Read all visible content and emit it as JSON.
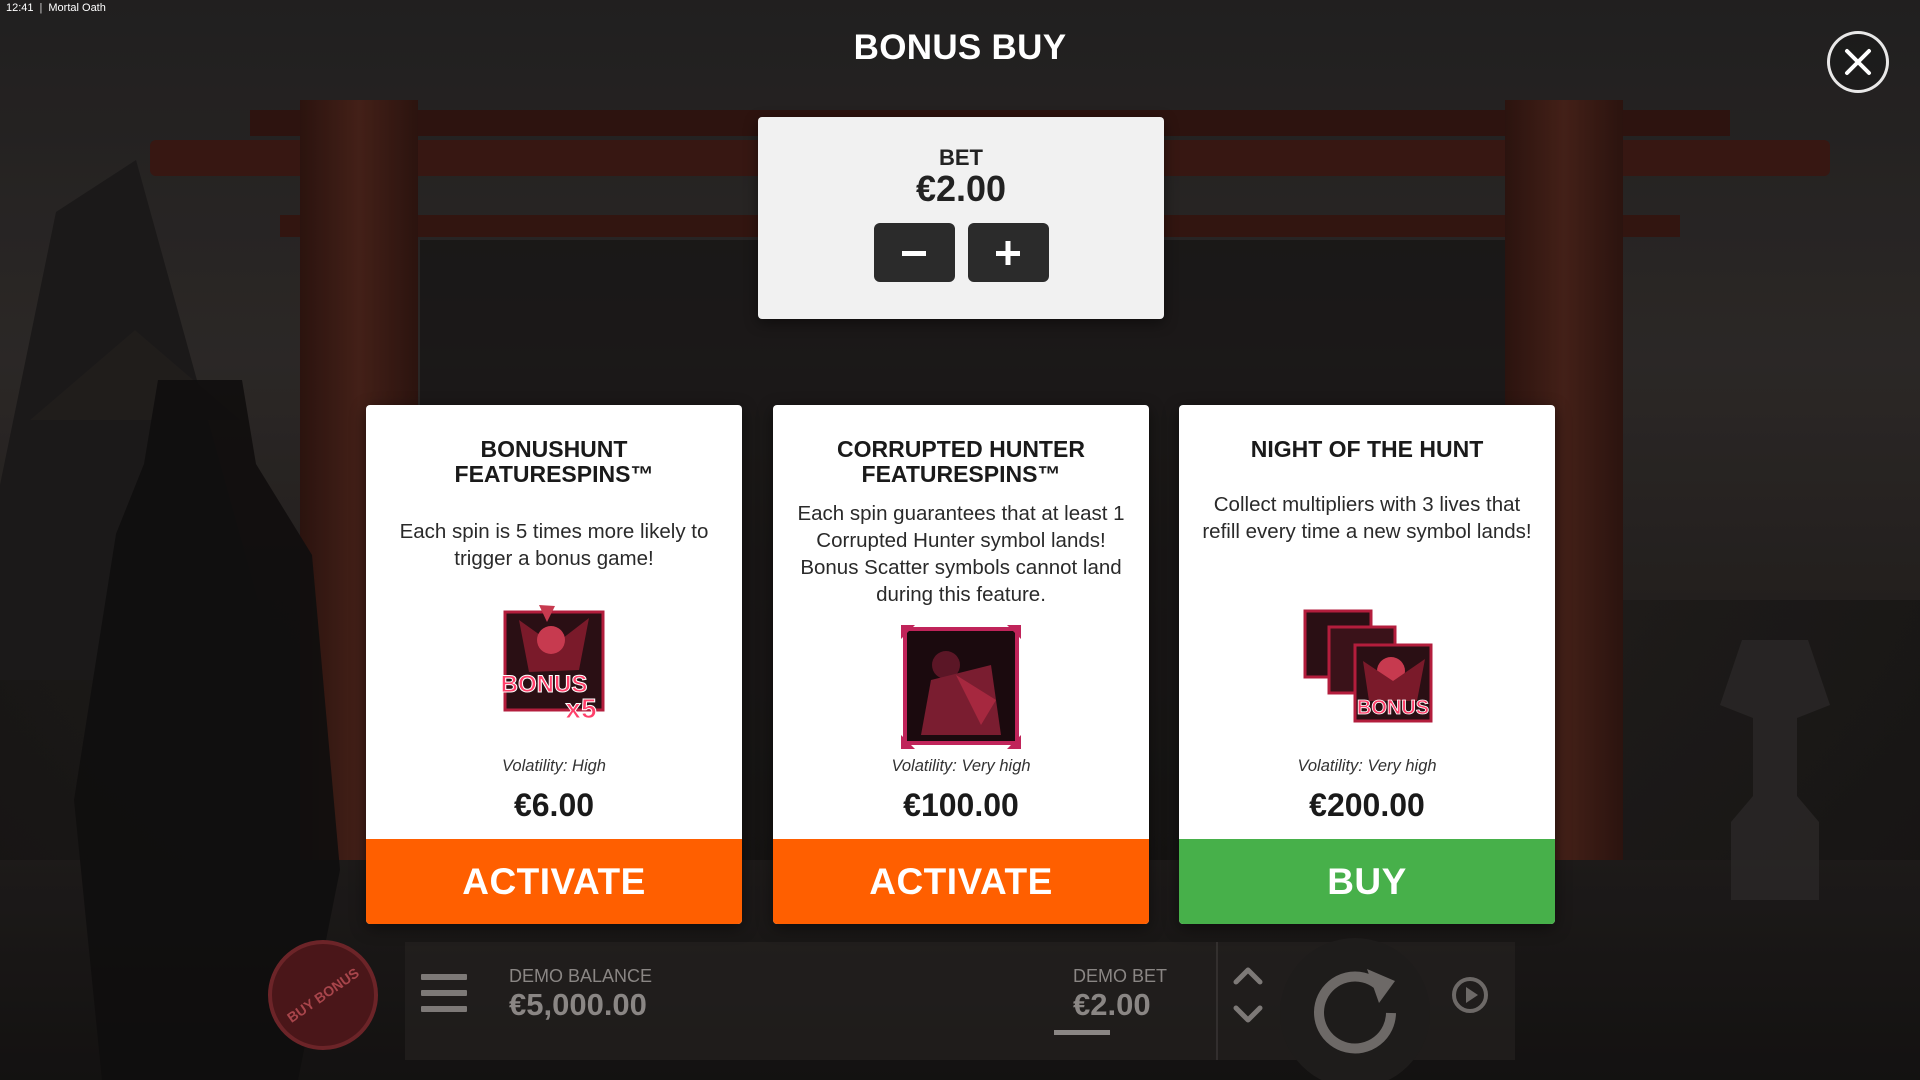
{
  "status_bar": {
    "time": "12:41",
    "separator": "|",
    "app_name": "Mortal Oath"
  },
  "header": {
    "title": "BONUS BUY"
  },
  "bet": {
    "label": "BET",
    "value": "€2.00",
    "minus_icon": "minus-icon",
    "plus_icon": "plus-icon"
  },
  "cards": [
    {
      "title": "BONUSHUNT FEATURESPINS™",
      "description": "Each spin is 5 times more likely to trigger a bonus game!",
      "image_icon": "bonus-x5-symbol",
      "image_text": "BONUS",
      "image_mult": "x5",
      "volatility": "Volatility: High",
      "price": "€6.00",
      "action": "ACTIVATE",
      "action_color": "#ff5f00"
    },
    {
      "title": "CORRUPTED HUNTER FEATURESPINS™",
      "description": "Each spin guarantees that at least 1 Corrupted Hunter symbol lands! Bonus Scatter symbols cannot land during this feature.",
      "image_icon": "corrupted-hunter-symbol",
      "volatility": "Volatility: Very high",
      "price": "€100.00",
      "action": "ACTIVATE",
      "action_color": "#ff5f00"
    },
    {
      "title": "NIGHT OF THE HUNT",
      "description": "Collect multipliers with 3 lives that refill every time a new symbol lands!",
      "image_icon": "stacked-bonus-symbols",
      "image_text": "BONUS",
      "volatility": "Volatility: Very high",
      "price": "€200.00",
      "action": "BUY",
      "action_color": "#47b04a"
    }
  ],
  "bottom": {
    "buy_bonus_label": "BUY BONUS",
    "balance_label": "DEMO BALANCE",
    "balance_value": "€5,000.00",
    "bet_label": "DEMO BET",
    "bet_value": "€2.00",
    "menu_icon": "hamburger-menu-icon",
    "spin_icon": "spin-icon",
    "autoplay_icon": "autoplay-icon"
  },
  "colors": {
    "accent_orange": "#ff5f00",
    "accent_green": "#47b04a",
    "panel": "#f1f1f1"
  }
}
